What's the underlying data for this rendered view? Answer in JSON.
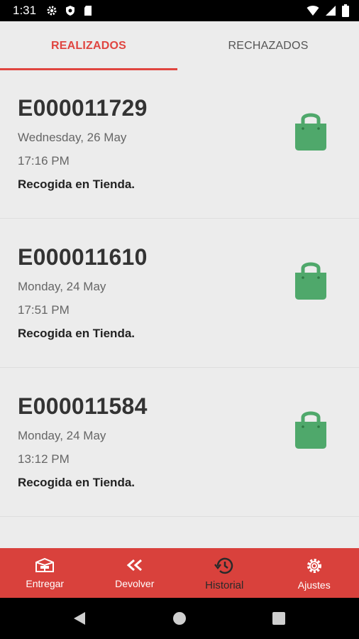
{
  "status_bar": {
    "time": "1:31"
  },
  "tabs": [
    {
      "label": "REALIZADOS",
      "active": true
    },
    {
      "label": "RECHAZADOS",
      "active": false
    }
  ],
  "orders": [
    {
      "code": "E000011729",
      "date": "Wednesday, 26 May",
      "time": "17:16 PM",
      "type": "Recogida en Tienda."
    },
    {
      "code": "E000011610",
      "date": "Monday, 24 May",
      "time": "17:51 PM",
      "type": "Recogida en Tienda."
    },
    {
      "code": "E000011584",
      "date": "Monday, 24 May",
      "time": "13:12 PM",
      "type": "Recogida en Tienda."
    }
  ],
  "bottom_nav": [
    {
      "label": "Entregar",
      "icon": "box-icon",
      "active": false
    },
    {
      "label": "Devolver",
      "icon": "double-chevron-left-icon",
      "active": false
    },
    {
      "label": "Historial",
      "icon": "history-icon",
      "active": true
    },
    {
      "label": "Ajustes",
      "icon": "gear-icon",
      "active": false
    }
  ],
  "colors": {
    "accent": "#e04540",
    "nav_bg": "#d9413c",
    "bag": "#4fa86b"
  }
}
